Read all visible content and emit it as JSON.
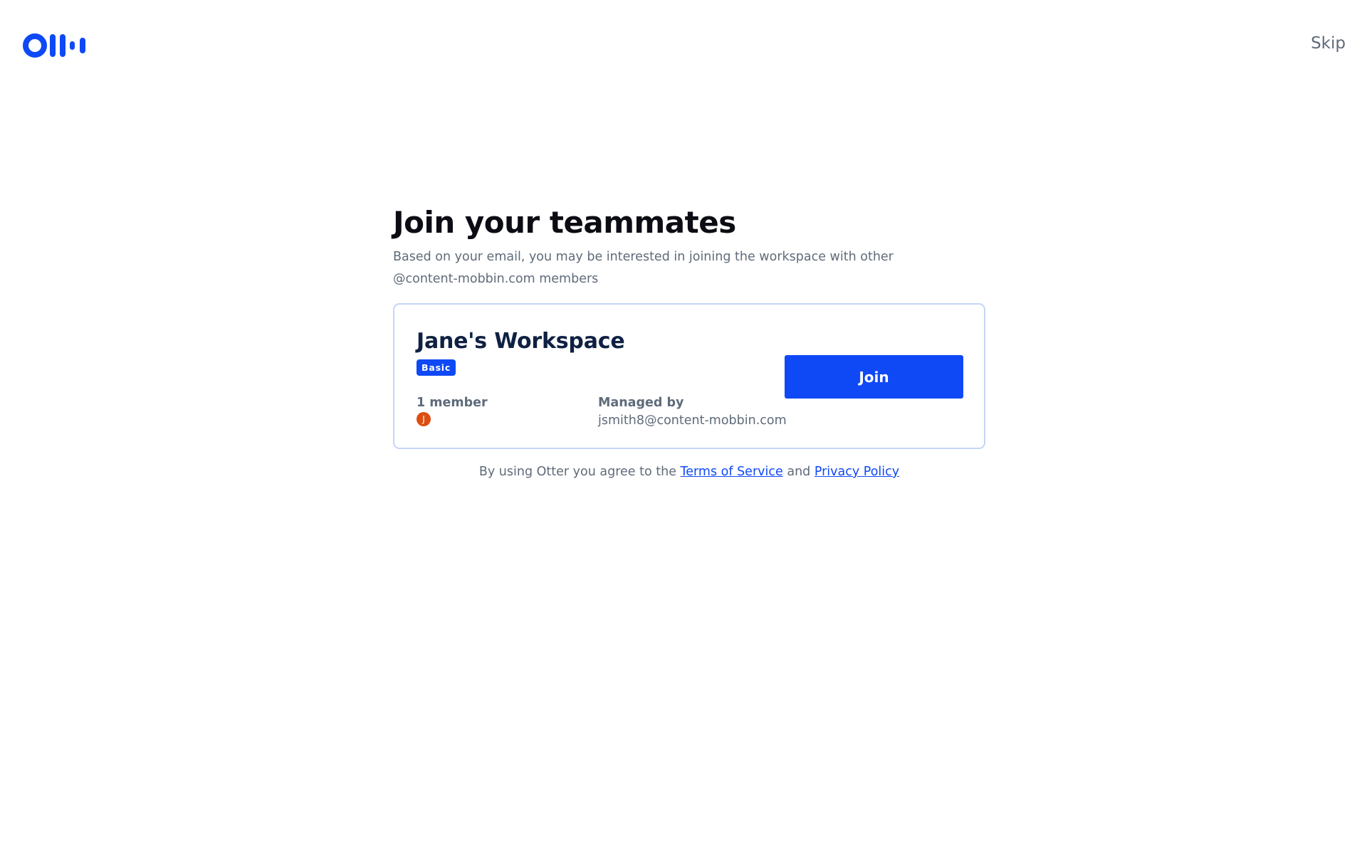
{
  "header": {
    "skip_label": "Skip"
  },
  "main": {
    "title": "Join your teammates",
    "subtitle": "Based on your email, you may be interested in joining the workspace with other @content-mobbin.com members"
  },
  "workspace": {
    "name": "Jane's Workspace",
    "plan_badge": "Basic",
    "members_label": "1 member",
    "avatar_initial": "J",
    "managed_by_label": "Managed by",
    "managed_by_email": "jsmith8@content-mobbin.com",
    "join_label": "Join"
  },
  "legal": {
    "prefix": "By using Otter you agree to the",
    "terms_label": "Terms of Service",
    "conjunction": "and",
    "privacy_label": "Privacy Policy"
  },
  "colors": {
    "brand": "#0f49f6",
    "text_muted": "#5f6b7a",
    "heading": "#0c0c14",
    "card_border": "#c4d6f7",
    "avatar": "#dc4e12"
  },
  "icons": {
    "logo": "otter-logo-icon"
  }
}
